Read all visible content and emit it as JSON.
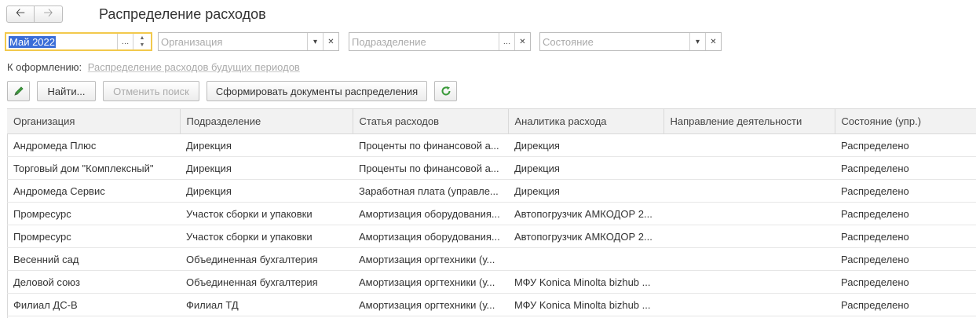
{
  "window": {
    "title": "Распределение расходов",
    "back_icon": "arrow-left-icon",
    "forward_icon": "arrow-right-icon"
  },
  "filters": {
    "period": {
      "value": "Май 2022"
    },
    "organization": {
      "placeholder": "Организация"
    },
    "department": {
      "placeholder": "Подразделение"
    },
    "state": {
      "placeholder": "Состояние"
    }
  },
  "todo": {
    "label": "К оформлению:",
    "link": "Распределение расходов будущих периодов"
  },
  "toolbar": {
    "find_label": "Найти...",
    "cancel_search_label": "Отменить поиск",
    "create_docs_label": "Сформировать документы распределения",
    "edit_icon": "pencil-icon",
    "refresh_icon": "refresh-icon"
  },
  "table": {
    "columns": [
      "Организация",
      "Подразделение",
      "Статья расходов",
      "Аналитика расхода",
      "Направление деятельности",
      "Состояние (упр.)"
    ],
    "rows": [
      [
        "Андромеда Плюс",
        "Дирекция",
        "Проценты по финансовой а...",
        "Дирекция",
        "",
        "Распределено"
      ],
      [
        "Торговый дом \"Комплексный\"",
        "Дирекция",
        "Проценты по финансовой а...",
        "Дирекция",
        "",
        "Распределено"
      ],
      [
        "Андромеда Сервис",
        "Дирекция",
        "Заработная плата (управле...",
        "Дирекция",
        "",
        "Распределено"
      ],
      [
        "Промресурс",
        "Участок сборки и упаковки",
        "Амортизация оборудования...",
        "Автопогрузчик АМКОДОР 2...",
        "",
        "Распределено"
      ],
      [
        "Промресурс",
        "Участок сборки и упаковки",
        "Амортизация оборудования...",
        "Автопогрузчик АМКОДОР 2...",
        "",
        "Распределено"
      ],
      [
        "Весенний сад",
        "Объединенная бухгалтерия",
        "Амортизация оргтехники (у...",
        "",
        "",
        "Распределено"
      ],
      [
        "Деловой союз",
        "Объединенная бухгалтерия",
        "Амортизация оргтехники (у...",
        "МФУ Konica Minolta bizhub ...",
        "",
        "Распределено"
      ],
      [
        "Филиал ДС-В",
        "Филиал ТД",
        "Амортизация оргтехники (у...",
        "МФУ Konica Minolta bizhub ...",
        "",
        "Распределено"
      ]
    ]
  }
}
